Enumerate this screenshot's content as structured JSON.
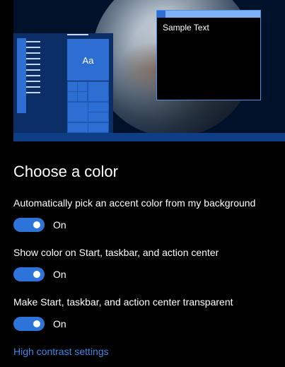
{
  "preview": {
    "tile_label": "Aa",
    "window_text": "Sample Text",
    "accent_color": "#2d6ed3"
  },
  "section": {
    "heading": "Choose a color"
  },
  "options": [
    {
      "label": "Automatically pick an accent color from my background",
      "state": "On",
      "enabled": true
    },
    {
      "label": "Show color on Start, taskbar, and action center",
      "state": "On",
      "enabled": true
    },
    {
      "label": "Make Start, taskbar, and action center transparent",
      "state": "On",
      "enabled": true
    }
  ],
  "links": {
    "high_contrast": "High contrast settings"
  }
}
